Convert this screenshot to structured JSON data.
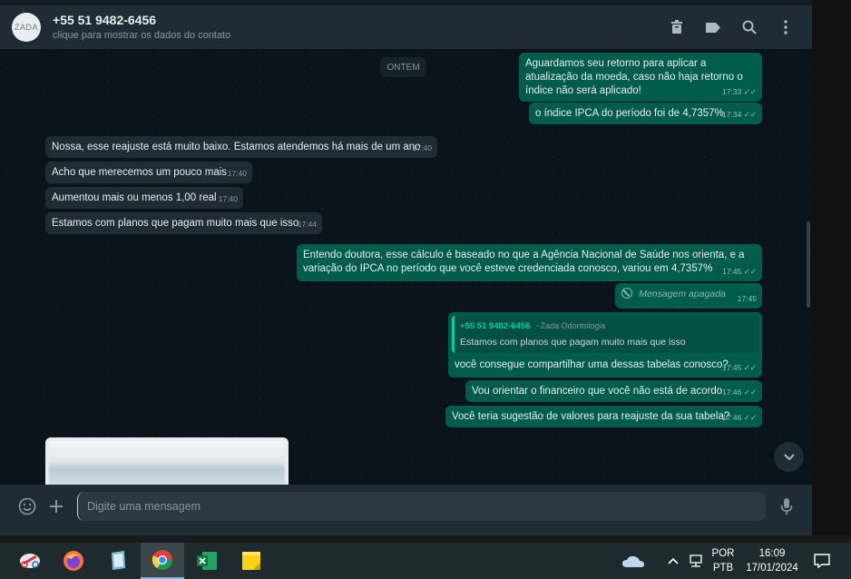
{
  "header": {
    "avatar_text": "ZADA",
    "contact_name": "+55 51 9482-6456",
    "contact_subtitle": "clique para mostrar os dados do contato",
    "icons": [
      "archive-icon",
      "label-icon",
      "search-icon",
      "menu-icon"
    ]
  },
  "chat": {
    "date_chip": "ONTEM",
    "messages": [
      {
        "dir": "out",
        "text": "Aguardamos seu retorno para aplicar a atualização da moeda, caso não haja retorno o índice não será aplicado!",
        "time": "17:33"
      },
      {
        "dir": "out",
        "text": "o índice IPCA do período foi de 4,7357%",
        "time": "17:34"
      },
      {
        "dir": "in",
        "text": "Nossa, esse reajuste está muito baixo. Estamos atendemos há mais de um ano",
        "time": "17:40"
      },
      {
        "dir": "in",
        "text": "Acho que merecemos um pouco mais",
        "time": "17:40"
      },
      {
        "dir": "in",
        "text": "Aumentou mais ou menos 1,00 real",
        "time": "17:40"
      },
      {
        "dir": "in",
        "text": "Estamos com planos que pagam muito mais que isso",
        "time": "17:44"
      },
      {
        "dir": "out",
        "text": "Entendo doutora, esse cálculo é baseado no que a Agência Nacional de Saúde nos orienta, e a variação do IPCA no período que você esteve credenciada conosco, variou em 4,7357%",
        "time": "17:45"
      },
      {
        "dir": "out",
        "text": "Mensagem apagada",
        "time": "17:45"
      },
      {
        "dir": "out",
        "text": "você consegue compartilhar uma dessas tabelas conosco?",
        "time": "17:45",
        "quote": {
          "sender": "+55 51 9482-6456",
          "alt_name": "~Zada Odontologia",
          "text": "Estamos com planos que pagam muito mais que isso"
        }
      },
      {
        "dir": "out",
        "text": "Vou orientar o financeiro que você não está de acordo",
        "time": "17:46"
      },
      {
        "dir": "out",
        "text": "Você teria sugestão de valores para reajuste da sua tabela?",
        "time": "17:46"
      }
    ]
  },
  "composer": {
    "placeholder": "Digite uma mensagem"
  },
  "taskbar": {
    "apps": [
      "snipping-tool-icon",
      "firefox-icon",
      "notepad-icon",
      "chrome-icon",
      "excel-icon",
      "sticky-notes-icon"
    ],
    "lang_top": "POR",
    "lang_bottom": "PTB",
    "time": "16:09",
    "date": "17/01/2024"
  }
}
